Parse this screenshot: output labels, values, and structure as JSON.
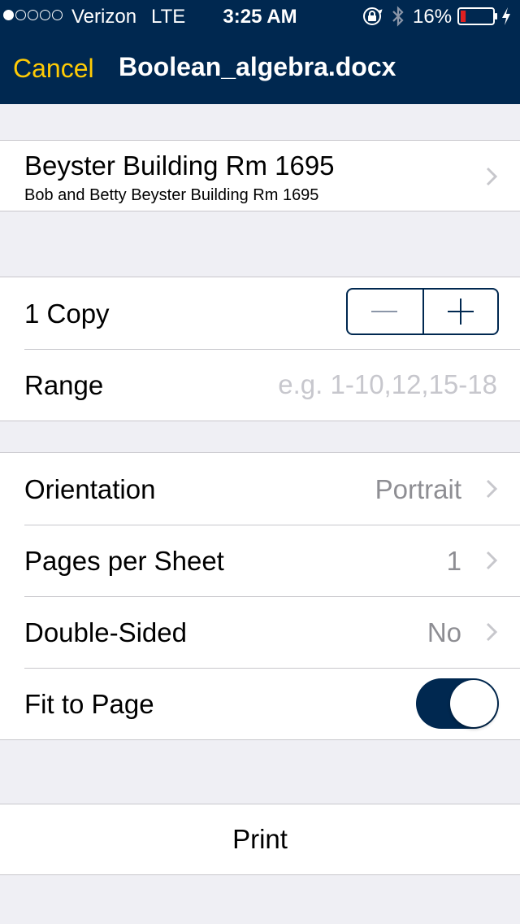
{
  "status_bar": {
    "signal_dots_filled": 1,
    "signal_dots_total": 5,
    "carrier": "Verizon",
    "network": "LTE",
    "time": "3:25 AM",
    "battery_percent": "16%",
    "battery_level": 0.16,
    "icons": [
      "orientation-lock-icon",
      "bluetooth-icon",
      "battery-icon",
      "charging-bolt-icon"
    ]
  },
  "nav": {
    "cancel_label": "Cancel",
    "title": "Boolean_algebra.docx"
  },
  "printer": {
    "name": "Beyster Building Rm 1695",
    "subtitle": "Bob and Betty Beyster Building Rm 1695"
  },
  "copies": {
    "label": "1 Copy",
    "count": 1
  },
  "range": {
    "label": "Range",
    "value": "",
    "placeholder": "e.g. 1-10,12,15-18"
  },
  "options": {
    "orientation": {
      "label": "Orientation",
      "value": "Portrait"
    },
    "pages_per_sheet": {
      "label": "Pages per Sheet",
      "value": "1"
    },
    "double_sided": {
      "label": "Double-Sided",
      "value": "No"
    },
    "fit_to_page": {
      "label": "Fit to Page",
      "on": true
    }
  },
  "print": {
    "label": "Print"
  },
  "colors": {
    "header_bg": "#002850",
    "cancel_accent": "#ffcb05",
    "page_bg": "#efeff4",
    "separator": "#c8c7cc",
    "secondary_text": "#8e8e93"
  }
}
